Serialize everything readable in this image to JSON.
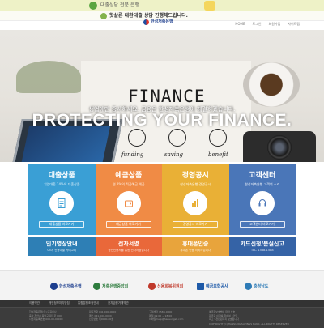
{
  "top_banner": {
    "text": "대출상담 전문 은행",
    "colors": {
      "background": "#eef2c7",
      "logo": "#5aa640"
    }
  },
  "sub_banner": {
    "text": "핫살론 대환대출 상담 진행해드립니다."
  },
  "utility_nav": [
    "HOME",
    "로그인",
    "회원가입",
    "사이트맵"
  ],
  "logo": {
    "name": "한성저축은행"
  },
  "hero": {
    "subtitle": "생업에만 종사하세요. 금융은 한성저축은행이 해결하겠습니다.",
    "headline": "PROTECTING YOUR FINANCE.",
    "board_text": "FINANCE",
    "doodles": [
      "funding",
      "saving",
      "benefit"
    ]
  },
  "services": [
    {
      "title": "대출상품",
      "desc": "기업대출 14%의 대출상품",
      "button": "대출상품 바로가기",
      "color": "#3a9fd5",
      "icon": "document-icon"
    },
    {
      "title": "예금상품",
      "desc": "연 2%의 적금예금 예금",
      "button": "예금상품 바로가기",
      "color": "#f08b45",
      "icon": "wallet-icon"
    },
    {
      "title": "경영공시",
      "desc": "한성저축은행 경영공시",
      "button": "경영공시 바로가기",
      "color": "#e9b036",
      "icon": "chart-icon"
    },
    {
      "title": "고객센터",
      "desc": "한성저축은행 고객의 소리",
      "button": "고객센터 바로가기",
      "color": "#4a76b8",
      "icon": "headset-icon"
    }
  ],
  "tiles": [
    {
      "title": "인기영장안내",
      "desc": "05개 신용대출 카테고리",
      "color": "#2e7fb5"
    },
    {
      "title": "전자서명",
      "desc": "공인인증서를 통한 전자서명입니다",
      "color": "#e9683a"
    },
    {
      "title": "휴대폰인증",
      "desc": "휴대폰 인증 서비스입니다",
      "color": "#e8a43c"
    },
    {
      "title": "카드신청/분실신고",
      "desc": "TEL. 1588-1588",
      "color": "#3563a6"
    }
  ],
  "partners": [
    {
      "name": "한성저축은행",
      "color": "#1e3f8f"
    },
    {
      "name": "저축은행중앙회",
      "color": "#2e7c3e"
    },
    {
      "name": "신용회복위원회",
      "color": "#c0392b"
    },
    {
      "name": "예금보험공사",
      "color": "#1e5aa8"
    },
    {
      "name": "충청남도",
      "color": "#2e7bb6"
    }
  ],
  "footer": {
    "nav": [
      "이용약관",
      "개인정보처리방침",
      "통합분쟁조정안내",
      "전자금융거래약관"
    ],
    "columns": [
      [
        "한성저축은행(주) 대표이사",
        "충남 천안시 동남구 대흥로 000",
        "사업자등록번호 000-00-00000"
      ],
      [
        "대표전화 041-000-0000",
        "팩스 041-000-0000",
        "신고번호 제0000-00호"
      ],
      [
        "고객센터 1588-0000",
        "평일 09:00 ~ 18:00",
        "이메일 help@hansungsb.com"
      ],
      [
        "예금자보호법에 따라 보호",
        "원금과 이자를 합하여 1인당",
        "최고 5천만원까지 보호됩니다"
      ]
    ],
    "copyright": "COPYRIGHT (C) HANSUNG SAVINGS BANK. ALL RIGHTS RESERVED"
  }
}
